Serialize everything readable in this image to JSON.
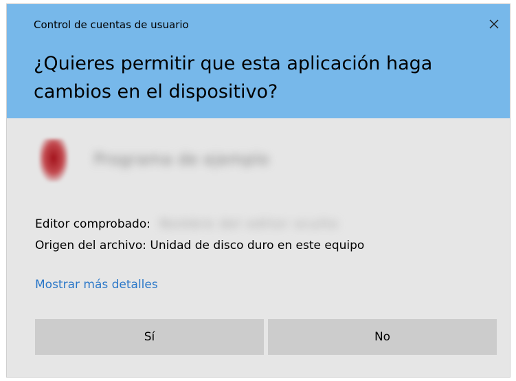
{
  "window": {
    "title": "Control de cuentas de usuario",
    "close_icon": "close-icon",
    "header_color": "#77b8ea",
    "body_color": "#e6e6e6"
  },
  "prompt": {
    "question": "¿Quieres permitir que esta aplicación haga cambios en el dispositivo?"
  },
  "app": {
    "icon": "app-icon",
    "name": "Programa de ejemplo"
  },
  "info": {
    "publisher_label": "Editor comprobado:",
    "publisher_value": "Nombre del editor oculto",
    "origin_label": "Origen del archivo:",
    "origin_value": "Unidad de disco duro en este equipo"
  },
  "links": {
    "more_details": "Mostrar más detalles",
    "link_color": "#2a77c8"
  },
  "buttons": {
    "yes_label": "Sí",
    "no_label": "No",
    "button_color": "#cccccc"
  }
}
